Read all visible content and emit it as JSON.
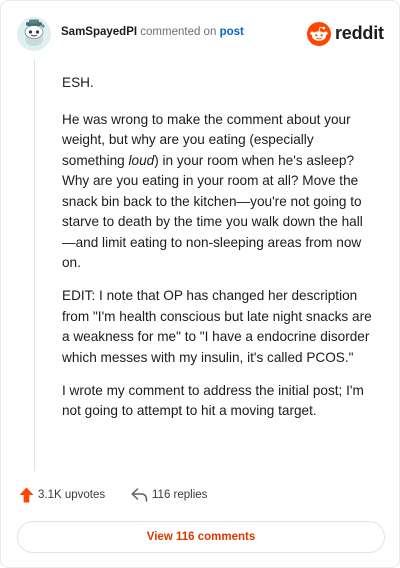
{
  "header": {
    "username": "SamSpayedPI",
    "action_text": "commented on",
    "post_link": "post",
    "brand_wordmark": "reddit",
    "avatar_icon": "snoo-avatar-icon",
    "brand_icon": "reddit-logo-icon"
  },
  "comment": {
    "p1": "ESH.",
    "p2_a": "He was wrong to make the comment about your weight, but why are you eating (especially something ",
    "p2_em": "loud",
    "p2_b": ") in your room when he's asleep? Why are you eating in your room at all? Move the snack bin back to the kitchen—you're not going to starve to death by the time you walk down the hall—and limit eating to non-sleeping areas from now on.",
    "p3": "EDIT: I note that OP has changed her description from \"I'm health conscious but late night snacks are a weakness for me\" to \"I have a endocrine disorder which messes with my insulin, it's called PCOS.\"",
    "p4": "I wrote my comment to address the initial post; I'm not going to attempt to hit a moving target."
  },
  "footer": {
    "upvotes": "3.1K upvotes",
    "replies": "116 replies",
    "view_button": "View 116 comments",
    "upvote_icon": "upvote-arrow-icon",
    "reply_icon": "reply-arrow-icon"
  },
  "colors": {
    "brand_orange": "#ff4500",
    "link_blue": "#0a63c6",
    "button_text": "#d93a00",
    "border": "#e4e4e4"
  }
}
